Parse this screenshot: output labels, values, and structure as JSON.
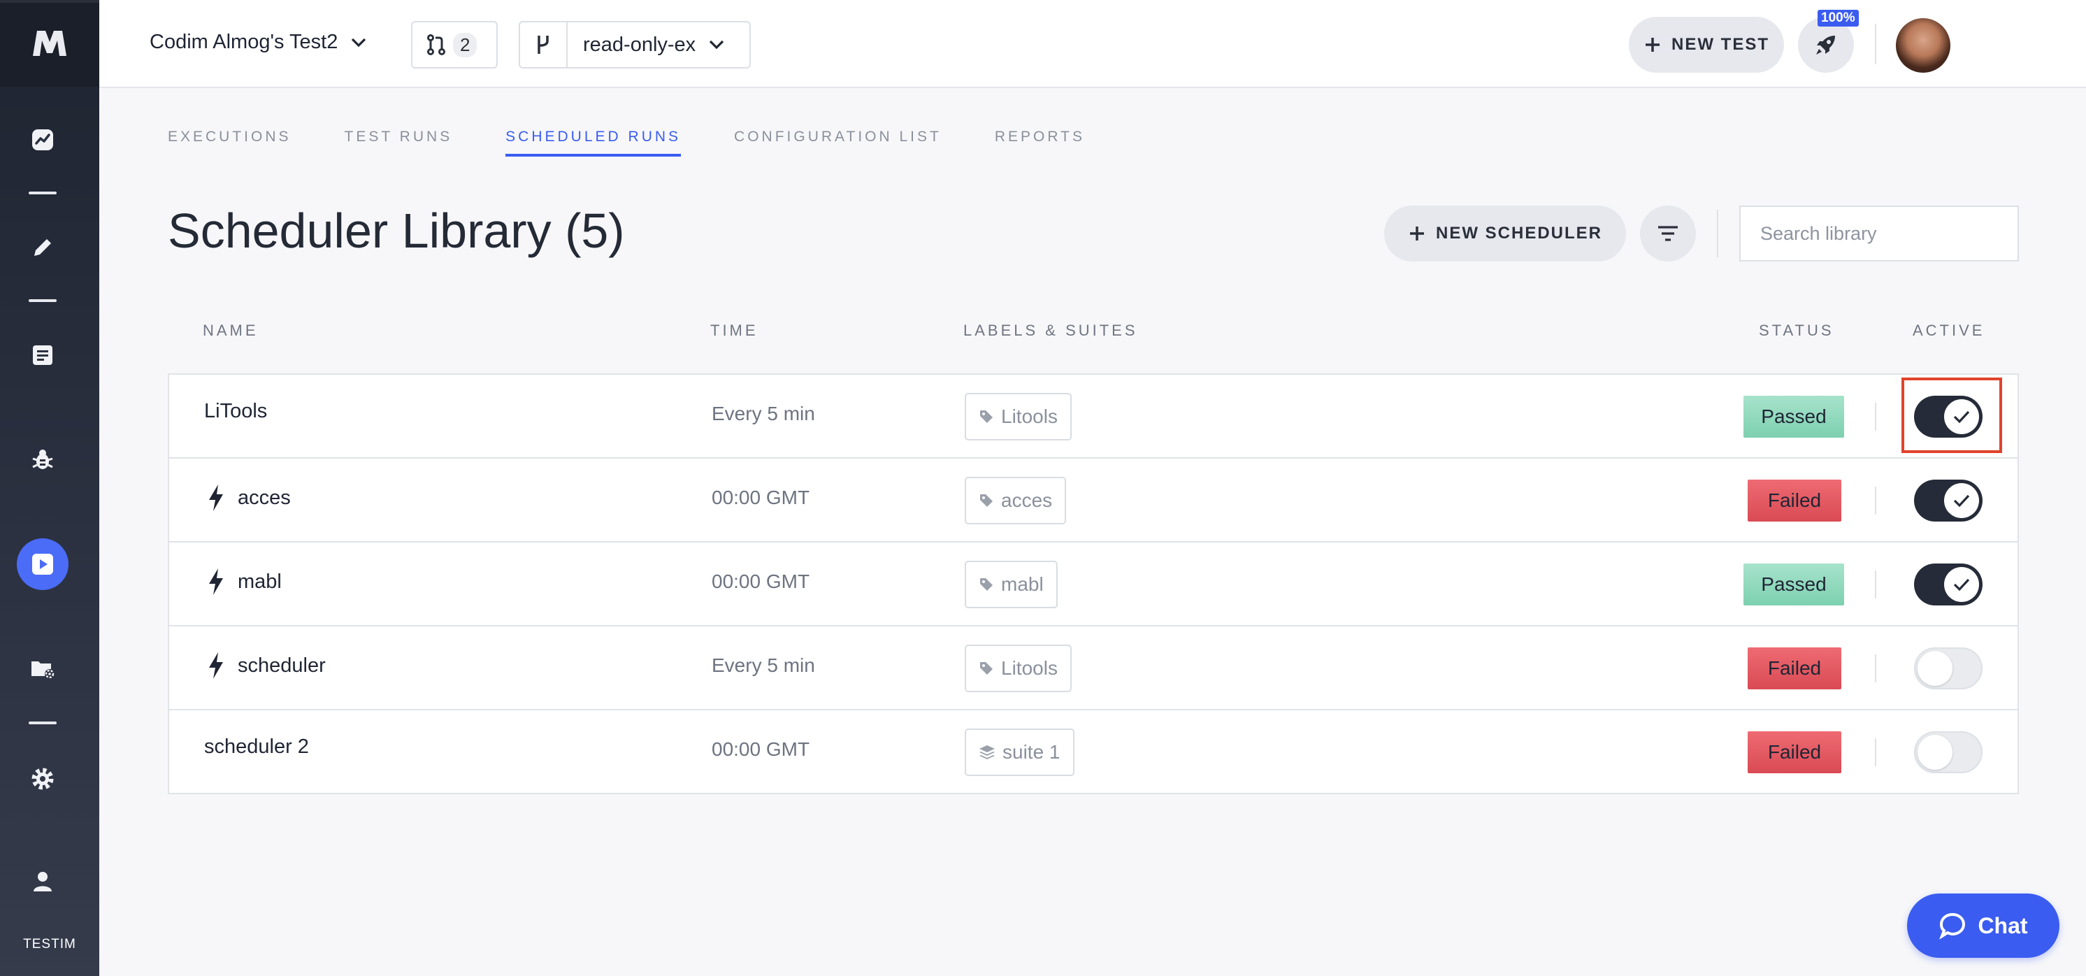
{
  "app": {
    "project_name": "Codim Almog's Test2",
    "branch_count": "2",
    "branch_name": "read-only-ex",
    "new_test_label": "NEW TEST",
    "quota_badge": "100%",
    "brand": "TESTIM",
    "accent_color": "#3a5cf0"
  },
  "sidebar": {
    "items": [
      {
        "icon": "dashboard-icon"
      },
      {
        "icon": "edit-icon"
      },
      {
        "icon": "list-icon"
      },
      {
        "icon": "bug-icon"
      },
      {
        "icon": "runs-icon",
        "active": true
      },
      {
        "icon": "folder-settings-icon"
      },
      {
        "icon": "gear-icon"
      },
      {
        "icon": "user-icon"
      }
    ]
  },
  "tabs": [
    "EXECUTIONS",
    "TEST RUNS",
    "SCHEDULED RUNS",
    "CONFIGURATION LIST",
    "REPORTS"
  ],
  "active_tab": "SCHEDULED RUNS",
  "page": {
    "title": "Scheduler Library (5)",
    "new_scheduler_label": "NEW SCHEDULER",
    "search_placeholder": "Search library"
  },
  "columns": {
    "name": "NAME",
    "time": "TIME",
    "labels": "LABELS & SUITES",
    "status": "STATUS",
    "active": "ACTIVE"
  },
  "rows": [
    {
      "name": "LiTools",
      "bolt": false,
      "time": "Every 5 min",
      "label": "Litools",
      "label_type": "tag",
      "status": "Passed",
      "active": true
    },
    {
      "name": "acces",
      "bolt": true,
      "time": "00:00 GMT",
      "label": "acces",
      "label_type": "tag",
      "status": "Failed",
      "active": true
    },
    {
      "name": "mabl",
      "bolt": true,
      "time": "00:00 GMT",
      "label": "mabl",
      "label_type": "tag",
      "status": "Passed",
      "active": true
    },
    {
      "name": "scheduler",
      "bolt": true,
      "time": "Every 5 min",
      "label": "Litools",
      "label_type": "tag",
      "status": "Failed",
      "active": false
    },
    {
      "name": "scheduler 2",
      "bolt": false,
      "time": "00:00 GMT",
      "label": "suite 1",
      "label_type": "suite",
      "status": "Failed",
      "active": false
    }
  ],
  "chat": {
    "label": "Chat"
  }
}
